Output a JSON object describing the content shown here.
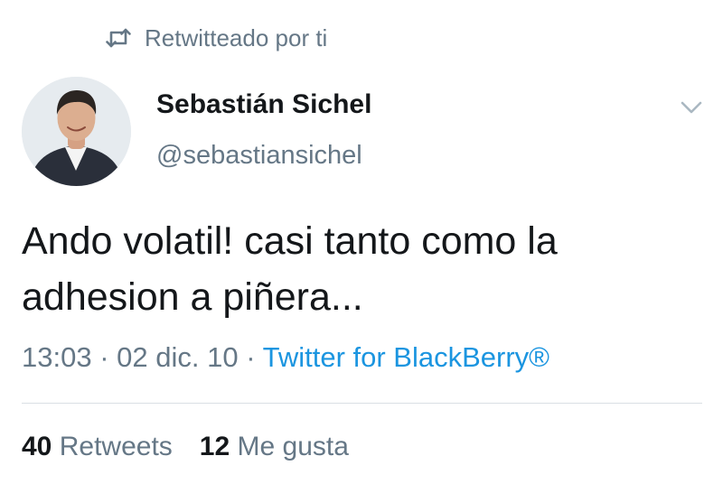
{
  "context": {
    "retweet_label": "Retwitteado por ti",
    "icon": "retweet-icon"
  },
  "author": {
    "display_name": "Sebastián Sichel",
    "handle": "@sebastiansichel",
    "avatar_icon": "profile-avatar"
  },
  "tweet": {
    "text_line1": "Ando volatil! casi tanto como la",
    "text_line2": "adhesion a piñera...",
    "time": "13:03",
    "date": "02 dic. 10",
    "separator": "·",
    "source": "Twitter for BlackBerry®"
  },
  "stats": {
    "retweets_count": "40",
    "retweets_label": "Retweets",
    "likes_count": "12",
    "likes_label": "Me gusta"
  },
  "colors": {
    "text": "#14171a",
    "secondary": "#657786",
    "link": "#1b95e0",
    "divider": "#d9dfe4"
  }
}
